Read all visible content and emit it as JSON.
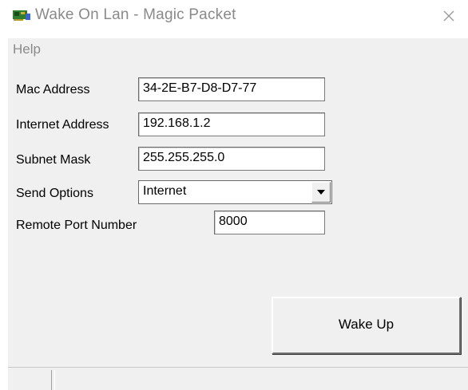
{
  "window": {
    "title": "Wake On Lan - Magic Packet",
    "close_glyph": "✕"
  },
  "menu": {
    "items": [
      "Help"
    ]
  },
  "form": {
    "mac_label": "Mac Address",
    "mac_value": "34-2E-B7-D8-D7-77",
    "ip_label": "Internet Address",
    "ip_value": "192.168.1.2",
    "subnet_label": "Subnet Mask",
    "subnet_value": "255.255.255.0",
    "send_label": "Send Options",
    "send_value": "Internet",
    "port_label": "Remote Port Number",
    "port_value": "8000"
  },
  "actions": {
    "wake_label": "Wake Up"
  },
  "icons": {
    "app": "network-card-icon",
    "close": "close-icon",
    "dropdown": "chevron-down-icon"
  },
  "colors": {
    "panel": "#f0f0f0",
    "title_text": "#8a8a8a",
    "field_bg": "#ffffff"
  }
}
